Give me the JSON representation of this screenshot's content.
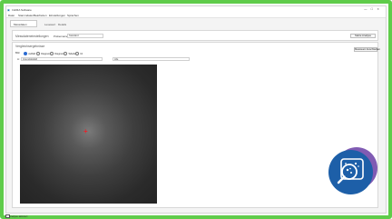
{
  "window": {
    "title": "ImFRA Software",
    "app_icon": "app-icon",
    "controls": [
      "—",
      "☐",
      "✕"
    ]
  },
  "menu": {
    "items": [
      "Datei",
      "Stammdaten",
      "Bearbeiten",
      "Einstellungen",
      "Sprachen"
    ]
  },
  "tabs": {
    "main": "Messdaten",
    "sub": [
      "Lesewert",
      "Details"
    ]
  },
  "group1": {
    "title": "Messdateneinstellungen",
    "field_label": "Probenname:",
    "field_value": "Standard",
    "button": "Starte Analyse"
  },
  "group2": {
    "title": "Vergleichsergebnisse",
    "button": "Messwert Anschließen",
    "radio_prefix": "Bild:",
    "radios": [
      "Aufbild",
      "Diagramm",
      "Diagramm",
      "Tabelle",
      "Inf"
    ],
    "selected_radio": 0,
    "field_a_label": "A:",
    "field_a_value": "Intensitätsfeld",
    "field_b_value": "Alle",
    "cursor_marker": "+"
  },
  "status": {
    "label": "Analyse aktiviert"
  },
  "fab": {
    "icon": "bacteria-search-icon",
    "color": "#1d5fa8",
    "shadow_color": "#6a3ea6"
  },
  "colors": {
    "frame": "#5fcc4a",
    "accent": "#2b6bd1",
    "marker": "#e8232a"
  }
}
